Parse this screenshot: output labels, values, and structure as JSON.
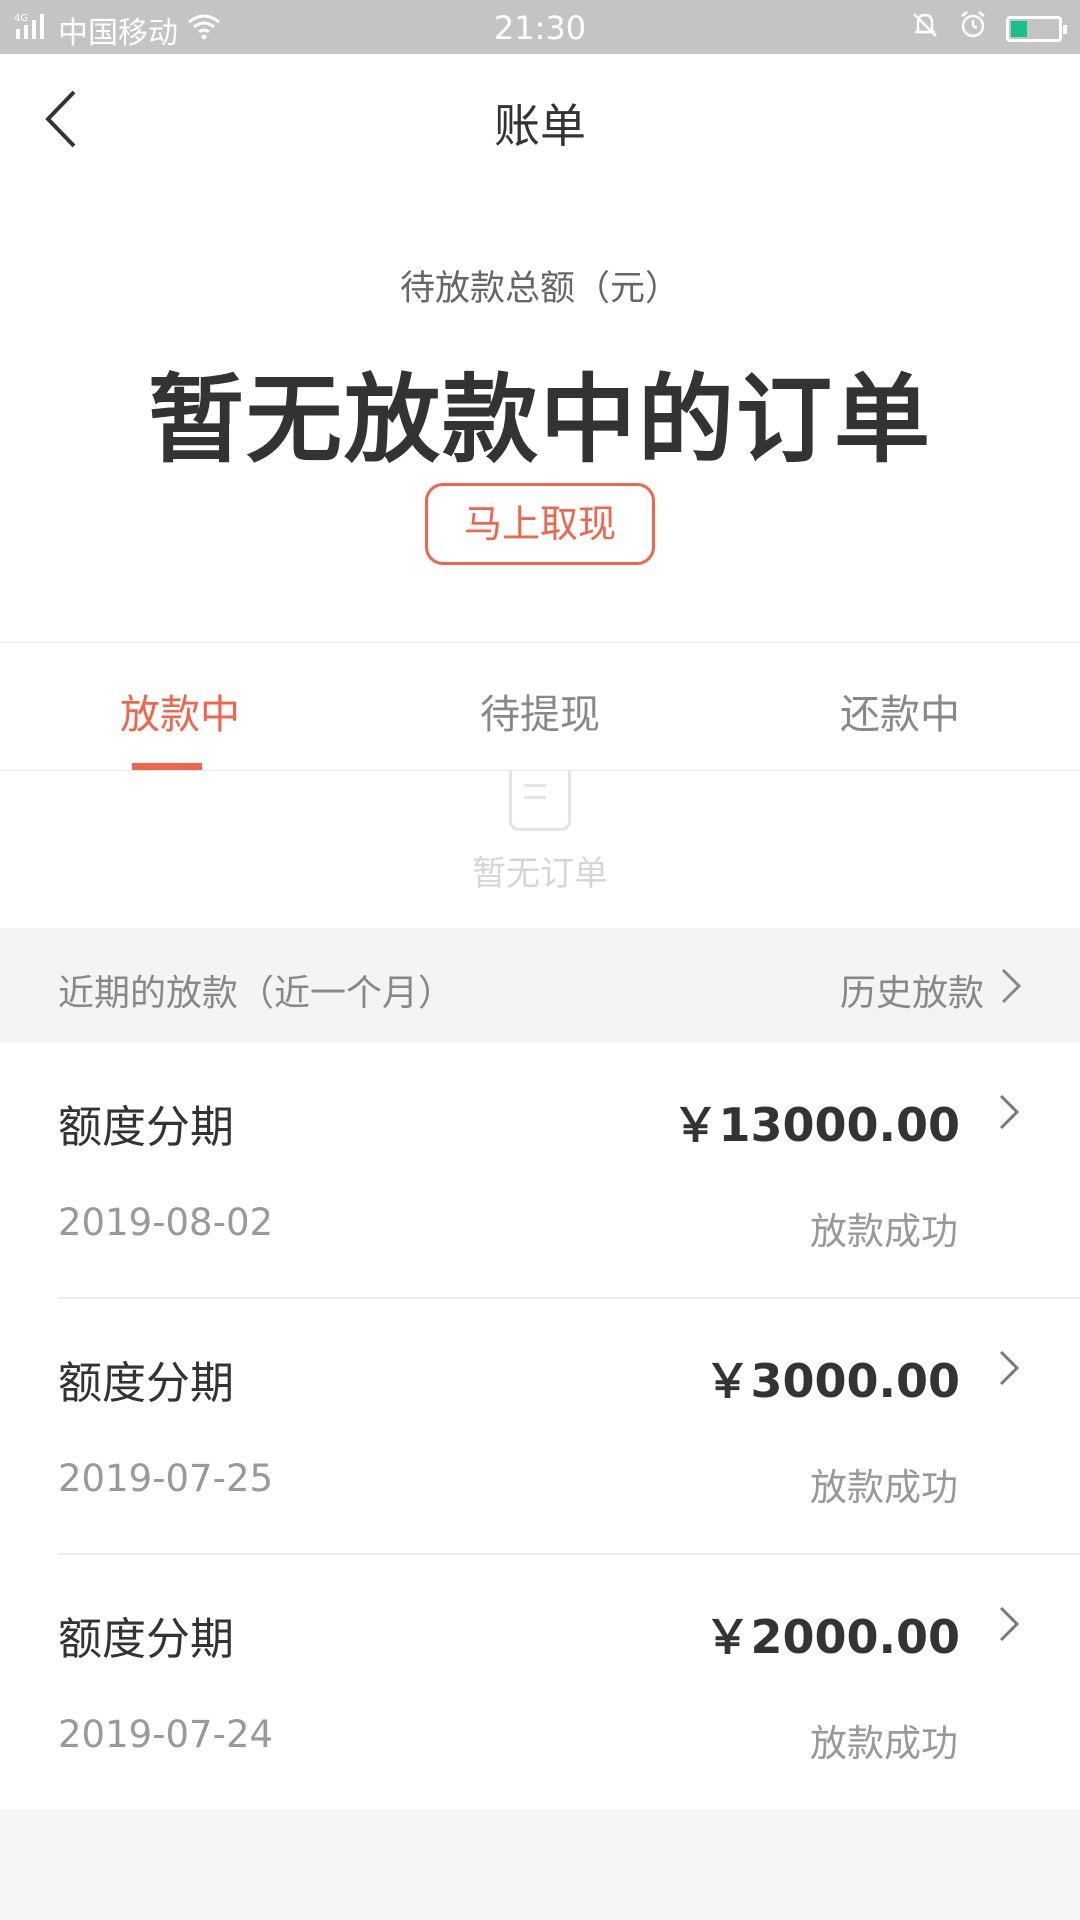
{
  "status_bar": {
    "network": "4G",
    "carrier": "中国移动",
    "time": "21:30"
  },
  "nav": {
    "title": "账单"
  },
  "summary": {
    "label": "待放款总额（元）",
    "main_text": "暂无放款中的订单",
    "button_label": "马上取现"
  },
  "tabs": [
    {
      "label": "放款中",
      "active": true
    },
    {
      "label": "待提现",
      "active": false
    },
    {
      "label": "还款中",
      "active": false
    }
  ],
  "empty_state": {
    "text": "暂无订单"
  },
  "recent": {
    "title": "近期的放款（近一个月）",
    "history_link": "历史放款",
    "items": [
      {
        "title": "额度分期",
        "amount": "￥13000.00",
        "date": "2019-08-02",
        "status": "放款成功"
      },
      {
        "title": "额度分期",
        "amount": "￥3000.00",
        "date": "2019-07-25",
        "status": "放款成功"
      },
      {
        "title": "额度分期",
        "amount": "￥2000.00",
        "date": "2019-07-24",
        "status": "放款成功"
      }
    ]
  },
  "colors": {
    "accent": "#f0654c",
    "status_bar_bg": "#c4c4c4",
    "battery_fill": "#18c08f"
  }
}
